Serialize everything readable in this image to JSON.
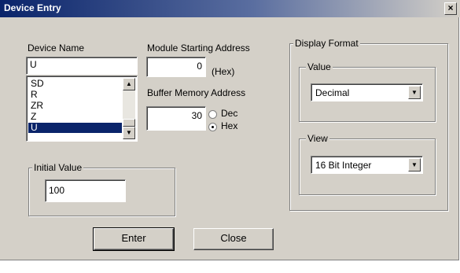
{
  "window": {
    "title": "Device Entry",
    "close_glyph": "×"
  },
  "device_name": {
    "label": "Device Name",
    "value": "U",
    "list": [
      "SD",
      "R",
      "ZR",
      "Z",
      "U"
    ],
    "selected": "U"
  },
  "module_address": {
    "label": "Module Starting Address",
    "value": "0",
    "unit": "(Hex)"
  },
  "buffer_address": {
    "label": "Buffer Memory Address",
    "value": "30",
    "radix_options": [
      "Dec",
      "Hex"
    ],
    "selected_radix": "Hex"
  },
  "initial_value": {
    "label": "Initial Value",
    "value": "100"
  },
  "display_format": {
    "label": "Display Format",
    "value_group": {
      "label": "Value",
      "selected": "Decimal"
    },
    "view_group": {
      "label": "View",
      "selected": "16 Bit Integer"
    }
  },
  "buttons": {
    "enter": "Enter",
    "close": "Close"
  },
  "icons": {
    "scroll_up": "scroll-up-arrow",
    "scroll_down": "scroll-down-arrow",
    "combo": "dropdown-arrow"
  }
}
